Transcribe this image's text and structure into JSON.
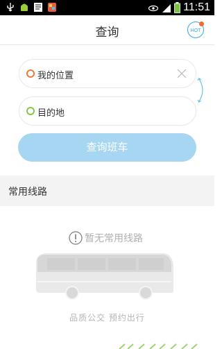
{
  "statusbar": {
    "time": "11:51"
  },
  "header": {
    "title": "查询",
    "hot_label": "HOT"
  },
  "search": {
    "from_value": "我的位置",
    "to_placeholder": "目的地",
    "submit_label": "查询班车"
  },
  "colors": {
    "accent_blue": "#a6d6f2",
    "from_dot": "#ec7a3c",
    "to_dot": "#8bc34a"
  },
  "frequent_routes": {
    "title": "常用线路",
    "empty_text": "暂无常用线路",
    "slogan": "品质公交  预约出行"
  }
}
